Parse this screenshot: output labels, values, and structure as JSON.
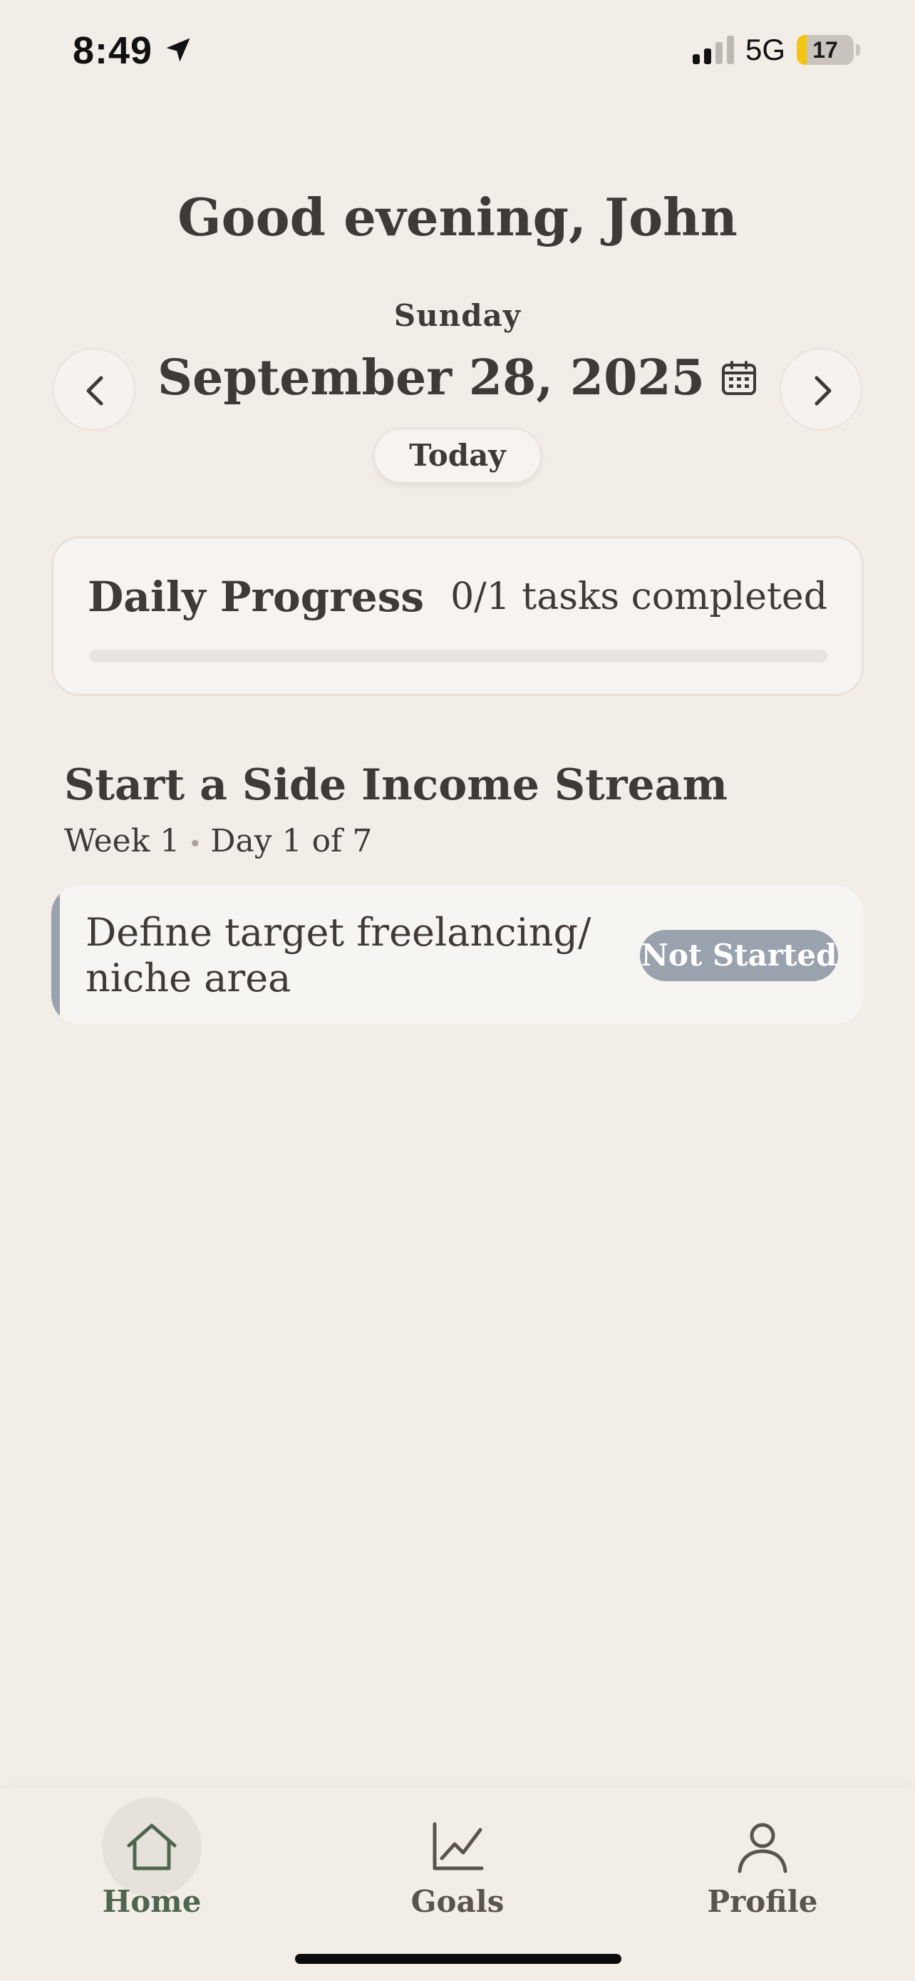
{
  "status_bar": {
    "time": "8:49",
    "network": "5G",
    "battery_level": "17",
    "battery_fraction": 0.17
  },
  "header": {
    "greeting": "Good evening, John",
    "weekday": "Sunday",
    "date": "September 28, 2025",
    "today_label": "Today"
  },
  "progress": {
    "title": "Daily Progress",
    "count_text": "0/1 tasks completed",
    "completed": 0,
    "total": 1
  },
  "goal": {
    "title": "Start a Side Income Stream",
    "week": "Week 1",
    "separator": "•",
    "day": "Day 1 of 7",
    "tasks": [
      {
        "text": "Define target freelancing/ niche area",
        "status": "Not Started"
      }
    ]
  },
  "tab_bar": {
    "active": "home",
    "items": [
      {
        "id": "home",
        "label": "Home",
        "icon": "home-icon"
      },
      {
        "id": "goals",
        "label": "Goals",
        "icon": "chart-icon"
      },
      {
        "id": "profile",
        "label": "Profile",
        "icon": "person-icon"
      }
    ]
  },
  "colors": {
    "background": "#f3ede7",
    "text": "#3f3a35",
    "accent_active": "#4e6650",
    "inactive_tab": "#5a544e",
    "status_not_started": "#9aa2ad"
  }
}
